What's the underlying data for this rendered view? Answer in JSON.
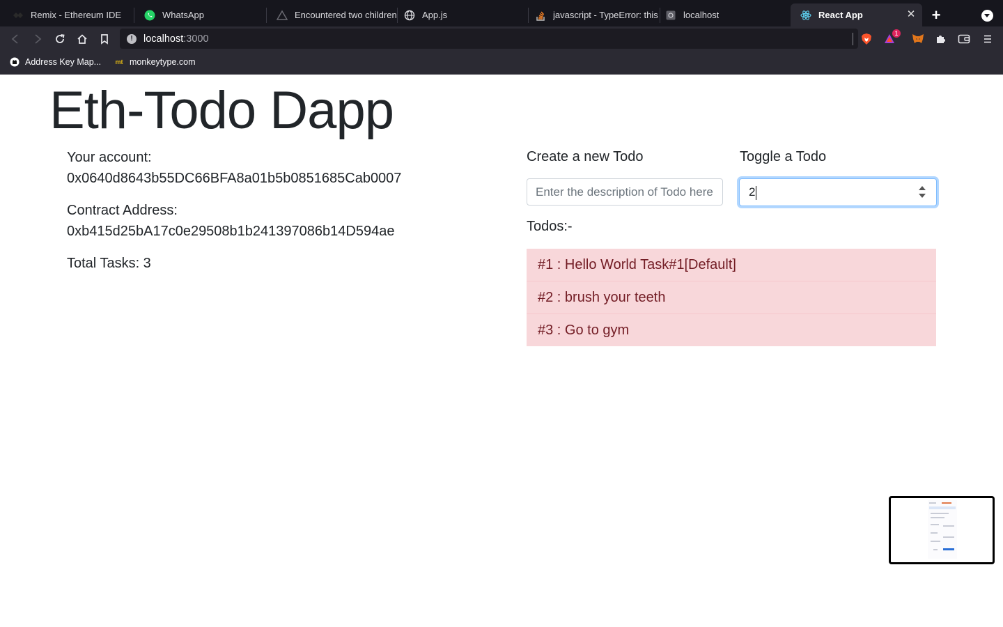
{
  "browser": {
    "tabs": [
      {
        "label": "Remix - Ethereum IDE",
        "icon": "remix-icon"
      },
      {
        "label": "WhatsApp",
        "icon": "whatsapp-icon"
      },
      {
        "label": "Encountered two children w",
        "icon": "vercel-icon"
      },
      {
        "label": "App.js",
        "icon": "globe-icon"
      },
      {
        "label": "javascript - TypeError: this",
        "icon": "stackoverflow-icon"
      },
      {
        "label": "localhost",
        "icon": "page-icon"
      },
      {
        "label": "React App",
        "icon": "react-icon",
        "active": true
      }
    ],
    "url_host": "localhost",
    "url_port": ":3000",
    "brave_rewards_badge": "1",
    "bookmarks": [
      {
        "label": "Address Key Map...",
        "icon": "github-icon"
      },
      {
        "label": "monkeytype.com",
        "icon": "monkeytype-icon",
        "icon_text": "mt"
      }
    ]
  },
  "app": {
    "title": "Eth-Todo Dapp",
    "account_label": "Your account:",
    "account_value": "0x0640d8643b55DC66BFA8a01b5b0851685Cab0007",
    "contract_label": "Contract Address:",
    "contract_value": "0xb415d25bA17c0e29508b1b241397086b14D594ae",
    "total_tasks": "Total Tasks: 3",
    "create_label": "Create a new Todo",
    "create_placeholder": "Enter the description of Todo here..",
    "toggle_label": "Toggle a Todo",
    "toggle_value": "2",
    "todos_label": "Todos:-",
    "todos": [
      "#1 : Hello World Task#1[Default]",
      "#2 : brush your teeth",
      "#3 : Go to gym"
    ]
  },
  "colors": {
    "todo_bg": "#f8d7da",
    "todo_text": "#721c24",
    "focus_border": "#80bdff"
  }
}
